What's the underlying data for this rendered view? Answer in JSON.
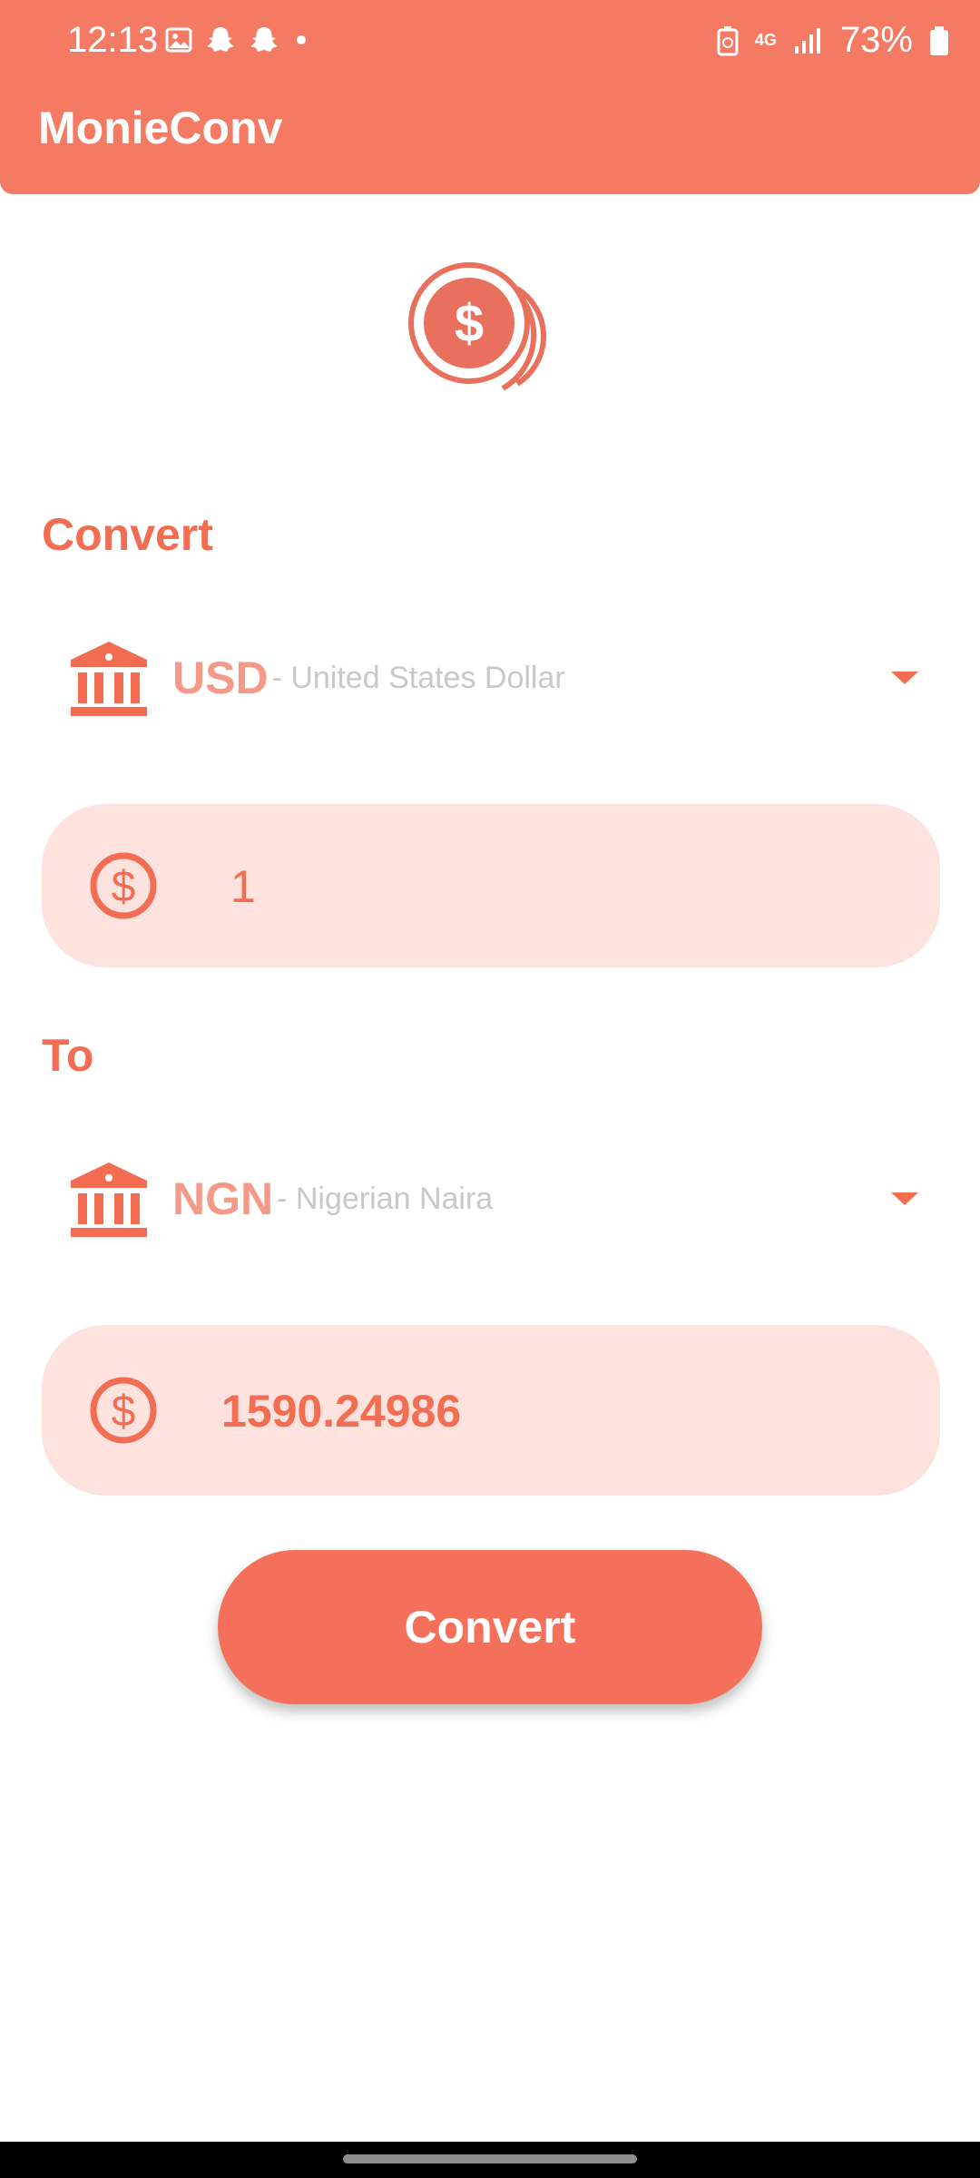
{
  "status_bar": {
    "time": "12:13",
    "network": "4G",
    "battery": "73%"
  },
  "app": {
    "title": "MonieConv"
  },
  "from": {
    "section_label": "Convert",
    "currency_code": "USD",
    "currency_name": "- United States Dollar",
    "amount": "1"
  },
  "to": {
    "section_label": "To",
    "currency_code": "NGN",
    "currency_name": "- Nigerian Naira",
    "amount": "1590.24986"
  },
  "convert_button": {
    "label": "Convert"
  },
  "colors": {
    "primary": "#F57A64",
    "field_bg": "#FDE2DE",
    "code_text": "#F59A88",
    "muted_text": "#C8C8C8"
  },
  "icons": {
    "logo": "coins-dollar-icon",
    "currency": "bank-icon",
    "amount": "dollar-circle-icon",
    "dropdown": "caret-down-icon"
  }
}
